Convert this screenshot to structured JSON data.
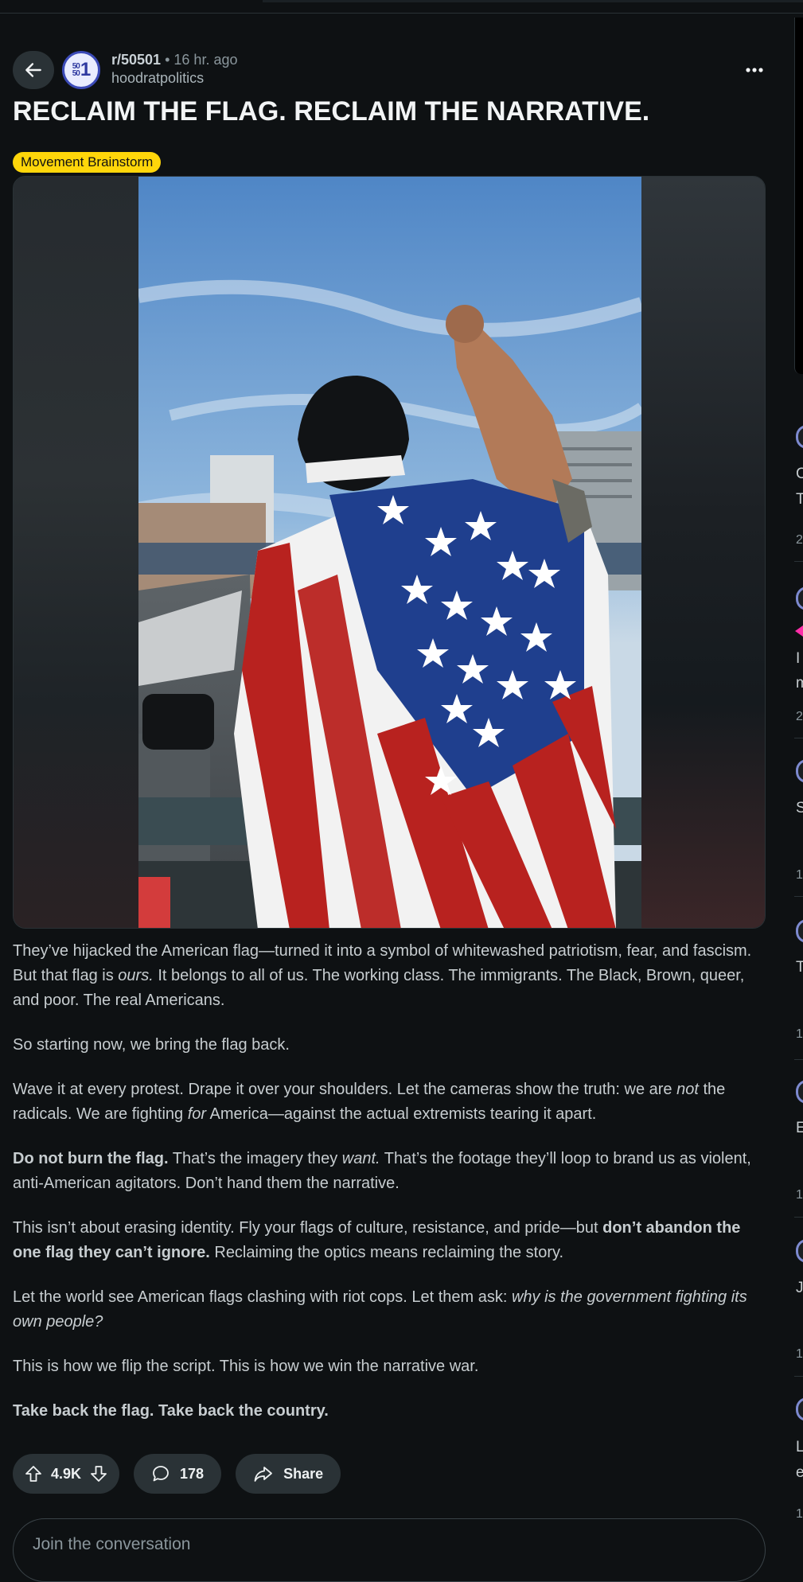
{
  "post": {
    "subreddit": "r/50501",
    "separator": "•",
    "time": "16 hr. ago",
    "author": "hoodratpolitics",
    "avatar_text": {
      "small_top": "50",
      "small_bottom": "50",
      "big": "1"
    },
    "title": "RECLAIM THE FLAG. RECLAIM THE NARRATIVE.",
    "flair": "Movement Brainstorm",
    "paragraphs": [
      [
        {
          "t": "They’ve hijacked the American flag—turned it into a symbol of whitewashed patriotism, fear, and fascism. But that flag is "
        },
        {
          "t": "ours.",
          "s": "i"
        },
        {
          "t": " It belongs to all of us. The working class. The immigrants. The Black, Brown, queer, and poor. The real Americans."
        }
      ],
      [
        {
          "t": "So starting now, we bring the flag back."
        }
      ],
      [
        {
          "t": "Wave it at every protest. Drape it over your shoulders. Let the cameras show the truth: we are "
        },
        {
          "t": "not",
          "s": "i"
        },
        {
          "t": " the radicals. We are fighting "
        },
        {
          "t": "for",
          "s": "i"
        },
        {
          "t": " America—against the actual extremists tearing it apart."
        }
      ],
      [
        {
          "t": "Do not burn the flag.",
          "s": "b"
        },
        {
          "t": " That’s the imagery they "
        },
        {
          "t": "want.",
          "s": "i"
        },
        {
          "t": " That’s the footage they’ll loop to brand us as violent, anti-American agitators. Don’t hand them the narrative."
        }
      ],
      [
        {
          "t": "This isn’t about erasing identity. Fly your flags of culture, resistance, and pride—but "
        },
        {
          "t": "don’t abandon the one flag they can’t ignore.",
          "s": "b"
        },
        {
          "t": " Reclaiming the optics means reclaiming the story."
        }
      ],
      [
        {
          "t": "Let the world see American flags clashing with riot cops. Let them ask: "
        },
        {
          "t": "why is the government fighting its own people?",
          "s": "i"
        }
      ],
      [
        {
          "t": "This is how we flip the script. This is how we win the narrative war."
        }
      ],
      [
        {
          "t": "Take back the flag. Take back the country.",
          "s": "b"
        }
      ]
    ]
  },
  "actions": {
    "votes": "4.9K",
    "comments": "178",
    "share": "Share"
  },
  "join": {
    "placeholder": "Join the conversation"
  },
  "icons": {
    "back": "back-arrow-icon",
    "more": "more-dots-icon",
    "upvote": "upvote-arrow-icon",
    "downvote": "downvote-arrow-icon",
    "comment": "comment-bubble-icon",
    "share": "share-arrow-icon"
  },
  "colors": {
    "background": "#0e1113",
    "flair": "#ffd60a",
    "pill": "#2a3236",
    "avatar_ring": "#3c4bb8"
  },
  "side_rail": {
    "texts": [
      "C",
      "T",
      "2",
      "I",
      "m",
      "2",
      "S",
      "1",
      "T",
      "1",
      "E",
      "1",
      "J",
      "1",
      "L",
      "e",
      "1"
    ]
  }
}
